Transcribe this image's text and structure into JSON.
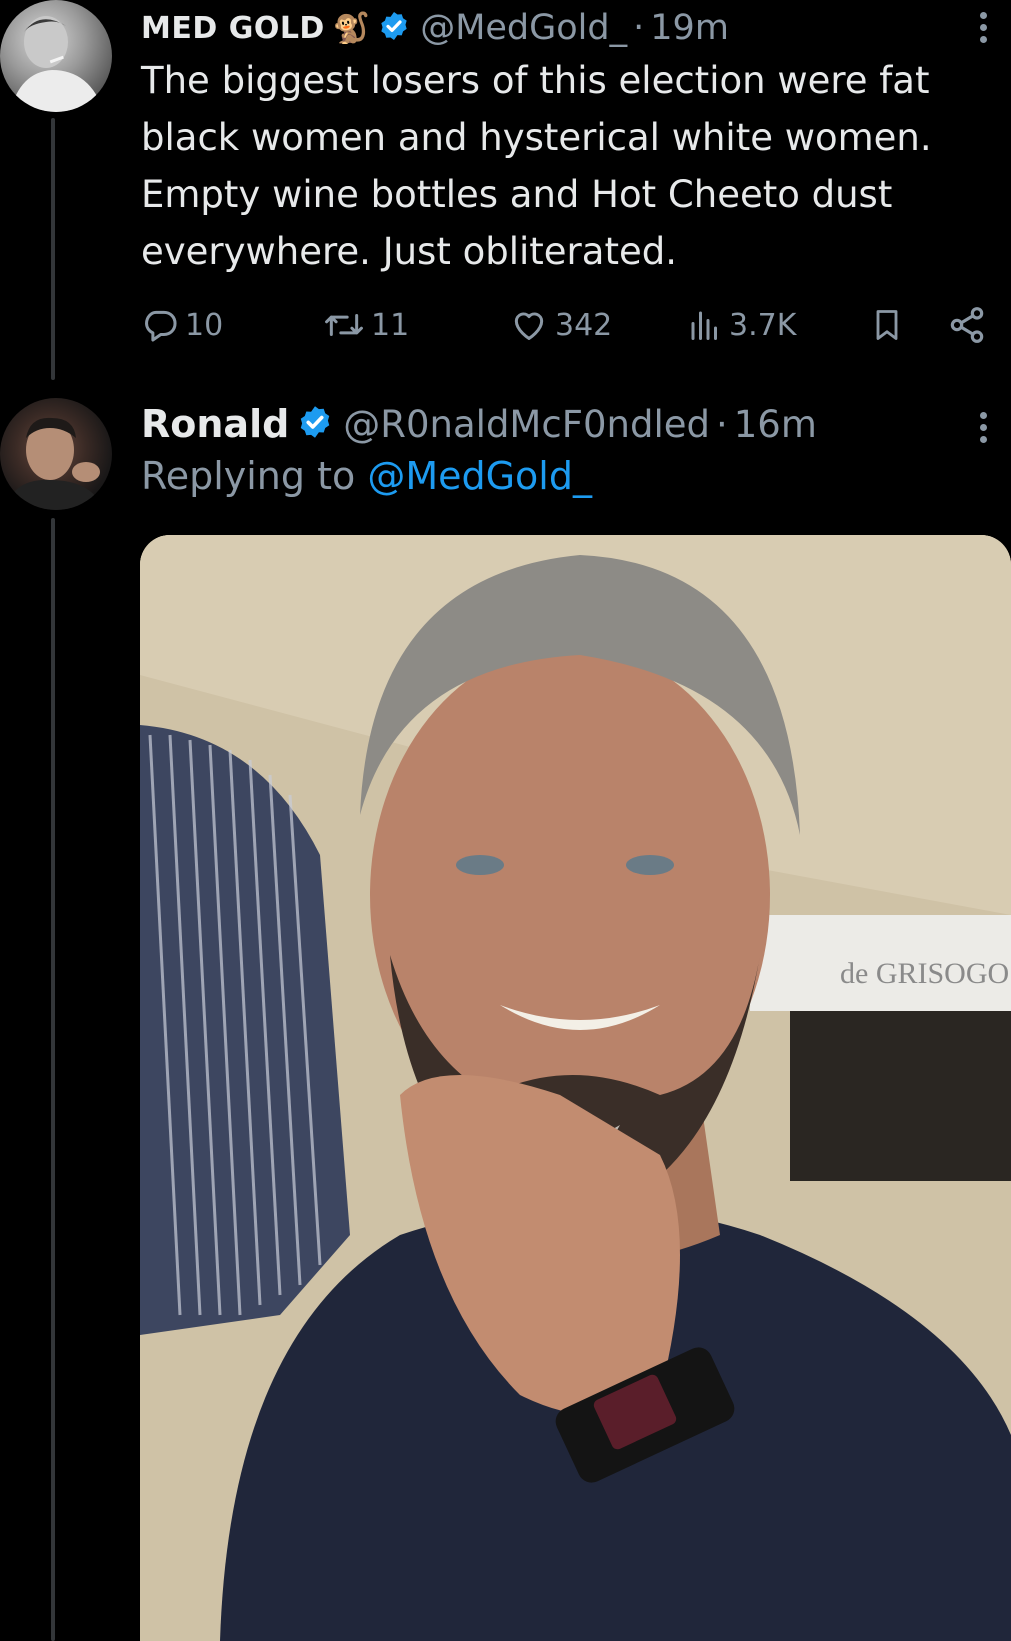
{
  "tweet": {
    "display_name": "MED GOLD",
    "name_emoji": "🐒",
    "handle": "@MedGold_",
    "separator": "·",
    "time": "19m",
    "text": "The biggest losers of this election were fat black women and hysterical white women. Empty wine bottles and Hot Cheeto dust everywhere. Just obliterated.",
    "actions": {
      "replies": "10",
      "reposts": "11",
      "likes": "342",
      "views": "3.7K"
    }
  },
  "reply": {
    "display_name": "Ronald",
    "handle": "@R0naldMcF0ndled",
    "separator": "·",
    "time": "16m",
    "replying_prefix": "Replying to",
    "replying_to": "@MedGold_",
    "media_sign_text": "de GRISOGO"
  },
  "colors": {
    "background": "#000000",
    "text": "#e7e9ea",
    "muted": "#8b98a5",
    "accent": "#1d9bf0",
    "thread_line": "#333639"
  },
  "icons": [
    "verified-badge-icon",
    "reply-icon",
    "repost-icon",
    "like-icon",
    "views-icon",
    "bookmark-icon",
    "share-icon",
    "more-options-icon"
  ]
}
